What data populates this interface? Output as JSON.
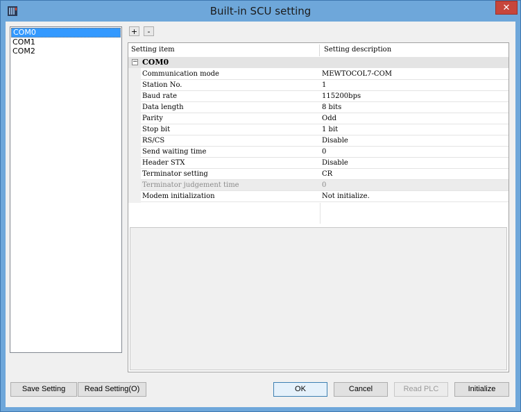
{
  "window": {
    "title": "Built-in SCU setting",
    "close_glyph": "✕"
  },
  "port_list": {
    "items": [
      {
        "label": "COM0",
        "selected": true
      },
      {
        "label": "COM1",
        "selected": false
      },
      {
        "label": "COM2",
        "selected": false
      }
    ]
  },
  "toolbar": {
    "expand_label": "+",
    "collapse_label": "-"
  },
  "grid": {
    "col1_header": "Setting item",
    "col2_header": "Setting description",
    "category": {
      "label": "COM0",
      "toggle": "−"
    },
    "rows": [
      {
        "item": "Communication mode",
        "value": "MEWTOCOL7-COM",
        "enabled": true
      },
      {
        "item": "Station No.",
        "value": "1",
        "enabled": true
      },
      {
        "item": "Baud rate",
        "value": "115200bps",
        "enabled": true
      },
      {
        "item": "Data length",
        "value": "8 bits",
        "enabled": true
      },
      {
        "item": "Parity",
        "value": "Odd",
        "enabled": true
      },
      {
        "item": "Stop bit",
        "value": "1 bit",
        "enabled": true
      },
      {
        "item": "RS/CS",
        "value": "Disable",
        "enabled": true
      },
      {
        "item": "Send waiting time",
        "value": "0",
        "enabled": true
      },
      {
        "item": "Header STX",
        "value": "Disable",
        "enabled": true
      },
      {
        "item": "Terminator setting",
        "value": "CR",
        "enabled": true
      },
      {
        "item": "Terminator judgement time",
        "value": "0",
        "enabled": false
      },
      {
        "item": "Modem initialization",
        "value": "Not initialize.",
        "enabled": true
      }
    ]
  },
  "buttons": {
    "save_setting": {
      "text": "Save Setting",
      "mnemonic": "S"
    },
    "read_setting": {
      "text": "Read Setting(O)",
      "mnemonic": "O"
    },
    "ok": {
      "text": "OK"
    },
    "cancel": {
      "text": "Cancel"
    },
    "read_plc": {
      "text": "Read PLC",
      "mnemonic": "R",
      "enabled": false
    },
    "initialize": {
      "text": "Initialize",
      "mnemonic": "I"
    }
  },
  "colors": {
    "frame": "#6ea7da",
    "selection": "#3399ff",
    "close": "#c7463c"
  },
  "icons": {
    "app": "plc-unit-icon",
    "close": "close-icon",
    "collapse": "minus-box-icon"
  }
}
